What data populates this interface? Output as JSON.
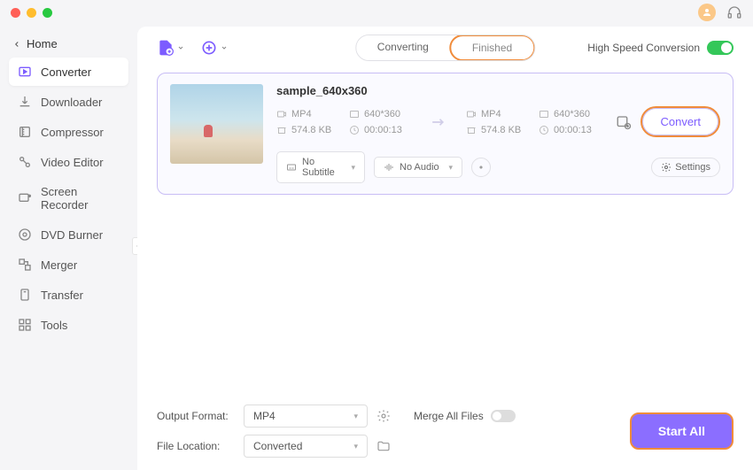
{
  "titlebar": {},
  "sidebar": {
    "home_label": "Home",
    "items": [
      {
        "label": "Converter",
        "icon": "converter-icon",
        "active": true
      },
      {
        "label": "Downloader",
        "icon": "downloader-icon"
      },
      {
        "label": "Compressor",
        "icon": "compressor-icon"
      },
      {
        "label": "Video Editor",
        "icon": "video-editor-icon"
      },
      {
        "label": "Screen Recorder",
        "icon": "screen-recorder-icon"
      },
      {
        "label": "DVD Burner",
        "icon": "dvd-burner-icon"
      },
      {
        "label": "Merger",
        "icon": "merger-icon"
      },
      {
        "label": "Transfer",
        "icon": "transfer-icon"
      },
      {
        "label": "Tools",
        "icon": "tools-icon"
      }
    ]
  },
  "header": {
    "tabs": {
      "converting": "Converting",
      "finished": "Finished"
    },
    "high_speed_label": "High Speed Conversion",
    "high_speed_on": true
  },
  "file": {
    "name": "sample_640x360",
    "source": {
      "format": "MP4",
      "resolution": "640*360",
      "size": "574.8 KB",
      "duration": "00:00:13"
    },
    "target": {
      "format": "MP4",
      "resolution": "640*360",
      "size": "574.8 KB",
      "duration": "00:00:13"
    },
    "subtitle_value": "No Subtitle",
    "audio_value": "No Audio",
    "settings_label": "Settings",
    "convert_label": "Convert"
  },
  "footer": {
    "output_format_label": "Output Format:",
    "output_format_value": "MP4",
    "file_location_label": "File Location:",
    "file_location_value": "Converted",
    "merge_label": "Merge All Files",
    "merge_on": false,
    "start_all_label": "Start All"
  }
}
